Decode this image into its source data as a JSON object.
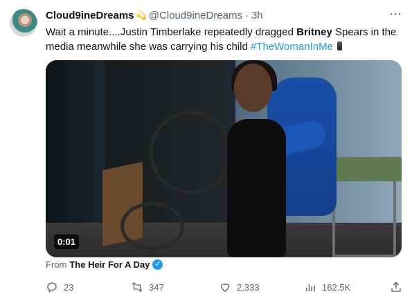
{
  "tweet": {
    "display_name": "Cloud9ineDreams",
    "name_emoji": "💫",
    "handle": "@Cloud9ineDreams",
    "separator": "·",
    "time": "3h",
    "more_icon": "more-icon",
    "text": {
      "part1": "Wait a minute....Justin Timberlake repeatedly dragged ",
      "bold": "Britney",
      "part2": " Spears in the media meanwhile she was carrying his child ",
      "hashtag": "#TheWomanInMe"
    },
    "media": {
      "timestamp": "0:01"
    },
    "attribution": {
      "prefix": "From",
      "source": "The Heir For A Day",
      "verified_icon": "verified-badge-icon"
    },
    "actions": {
      "replies": "23",
      "retweets": "347",
      "likes": "2,333",
      "views": "162.5K"
    }
  },
  "colors": {
    "accent": "#1d9bf0",
    "text_primary": "#0f1419",
    "text_secondary": "#536471"
  }
}
